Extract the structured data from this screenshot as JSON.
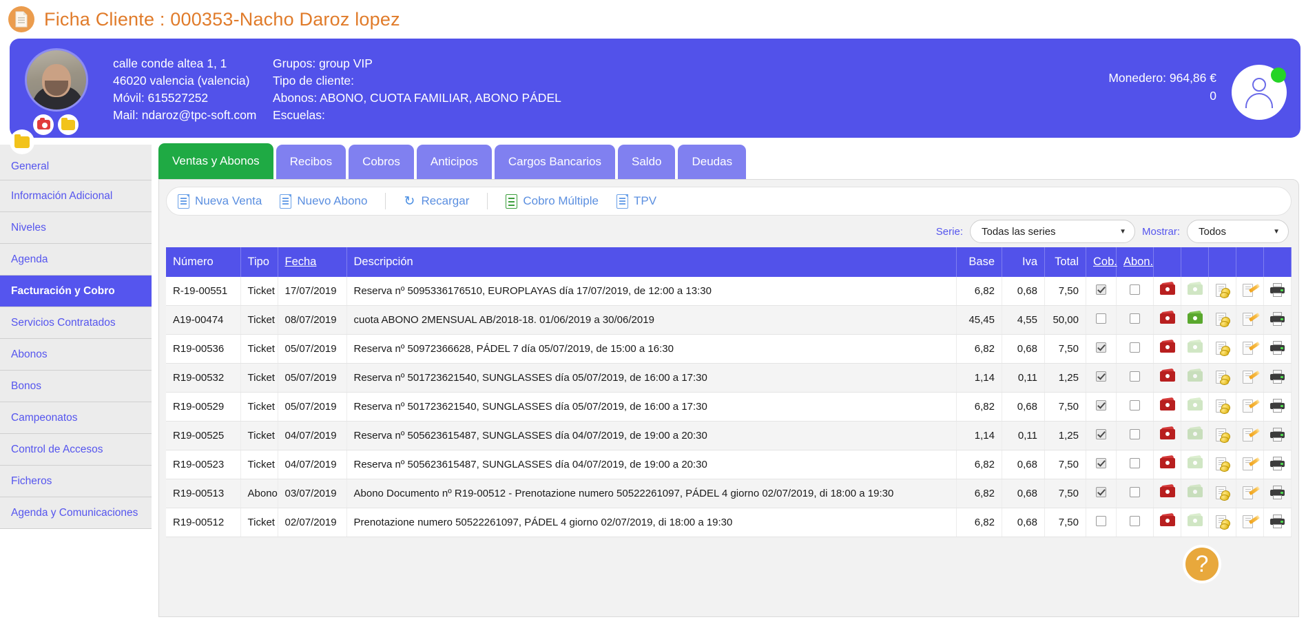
{
  "page": {
    "title": "Ficha Cliente : 000353-Nacho Daroz lopez",
    "doc_icon": "document-icon"
  },
  "client": {
    "address_line1": "calle conde altea 1, 1",
    "address_line2": "46020 valencia (valencia)",
    "mobile": "Móvil: 615527252",
    "mail": "Mail: ndaroz@tpc-soft.com",
    "groups": "Grupos: group VIP",
    "client_type": "Tipo de cliente:",
    "abonos": "Abonos: ABONO, CUOTA FAMILIAR, ABONO PÁDEL",
    "escuelas": "Escuelas:",
    "wallet": "Monedero: 964,86 €",
    "wallet_secondary": "0",
    "photo_badges": [
      "camera-icon",
      "folder-icon"
    ],
    "status": "online"
  },
  "sidebar": {
    "items": [
      {
        "label": "General",
        "active": false
      },
      {
        "label": "Información Adicional",
        "active": false
      },
      {
        "label": "Niveles",
        "active": false
      },
      {
        "label": "Agenda",
        "active": false
      },
      {
        "label": "Facturación y Cobro",
        "active": true
      },
      {
        "label": "Servicios Contratados",
        "active": false
      },
      {
        "label": "Abonos",
        "active": false
      },
      {
        "label": "Bonos",
        "active": false
      },
      {
        "label": "Campeonatos",
        "active": false
      },
      {
        "label": "Control de Accesos",
        "active": false
      },
      {
        "label": "Ficheros",
        "active": false
      },
      {
        "label": "Agenda y Comunicaciones",
        "active": false
      }
    ]
  },
  "tabs": [
    {
      "label": "Ventas y Abonos",
      "active": true
    },
    {
      "label": "Recibos",
      "active": false
    },
    {
      "label": "Cobros",
      "active": false
    },
    {
      "label": "Anticipos",
      "active": false
    },
    {
      "label": "Cargos Bancarios",
      "active": false
    },
    {
      "label": "Saldo",
      "active": false
    },
    {
      "label": "Deudas",
      "active": false
    }
  ],
  "toolbar": {
    "actions": [
      {
        "label": "Nueva Venta",
        "icon": "new-document-icon"
      },
      {
        "label": "Nuevo Abono",
        "icon": "new-document-icon"
      },
      {
        "label": "Recargar",
        "icon": "refresh-icon"
      },
      {
        "label": "Cobro Múltiple",
        "icon": "list-icon"
      },
      {
        "label": "TPV",
        "icon": "new-document-icon"
      }
    ]
  },
  "filters": {
    "serie_label": "Serie:",
    "serie_value": "Todas las series",
    "mostrar_label": "Mostrar:",
    "mostrar_value": "Todos"
  },
  "table": {
    "columns": [
      {
        "key": "numero",
        "label": "Número",
        "sortable": false
      },
      {
        "key": "tipo",
        "label": "Tipo",
        "sortable": false
      },
      {
        "key": "fecha",
        "label": "Fecha",
        "sortable": true
      },
      {
        "key": "descripcion",
        "label": "Descripción",
        "sortable": false
      },
      {
        "key": "base",
        "label": "Base",
        "sortable": false
      },
      {
        "key": "iva",
        "label": "Iva",
        "sortable": false
      },
      {
        "key": "total",
        "label": "Total",
        "sortable": false
      },
      {
        "key": "cob",
        "label": "Cob.",
        "sortable": true
      },
      {
        "key": "abon",
        "label": "Abon.",
        "sortable": true
      }
    ],
    "action_icons": [
      "money-red-icon",
      "money-green-icon",
      "document-coins-icon",
      "document-edit-icon",
      "printer-icon"
    ],
    "rows": [
      {
        "numero": "R-19-00551",
        "tipo": "Ticket",
        "fecha": "17/07/2019",
        "descripcion": "Reserva nº 5095336176510, EUROPLAYAS día 17/07/2019, de 12:00 a 13:30",
        "base": "6,82",
        "iva": "0,68",
        "total": "7,50",
        "cob": true,
        "abon": false,
        "green_active": false
      },
      {
        "numero": "A19-00474",
        "tipo": "Ticket",
        "fecha": "08/07/2019",
        "descripcion": "cuota ABONO 2MENSUAL AB/2018-18. 01/06/2019 a 30/06/2019",
        "base": "45,45",
        "iva": "4,55",
        "total": "50,00",
        "cob": false,
        "abon": false,
        "green_active": true
      },
      {
        "numero": "R19-00536",
        "tipo": "Ticket",
        "fecha": "05/07/2019",
        "descripcion": "Reserva nº 50972366628, PÁDEL 7 día 05/07/2019, de 15:00 a 16:30",
        "base": "6,82",
        "iva": "0,68",
        "total": "7,50",
        "cob": true,
        "abon": false,
        "green_active": false
      },
      {
        "numero": "R19-00532",
        "tipo": "Ticket",
        "fecha": "05/07/2019",
        "descripcion": "Reserva nº 501723621540, SUNGLASSES día 05/07/2019, de 16:00 a 17:30",
        "base": "1,14",
        "iva": "0,11",
        "total": "1,25",
        "cob": true,
        "abon": false,
        "green_active": false
      },
      {
        "numero": "R19-00529",
        "tipo": "Ticket",
        "fecha": "05/07/2019",
        "descripcion": "Reserva nº 501723621540, SUNGLASSES día 05/07/2019, de 16:00 a 17:30",
        "base": "6,82",
        "iva": "0,68",
        "total": "7,50",
        "cob": true,
        "abon": false,
        "green_active": false
      },
      {
        "numero": "R19-00525",
        "tipo": "Ticket",
        "fecha": "04/07/2019",
        "descripcion": "Reserva nº 505623615487, SUNGLASSES día 04/07/2019, de 19:00 a 20:30",
        "base": "1,14",
        "iva": "0,11",
        "total": "1,25",
        "cob": true,
        "abon": false,
        "green_active": false
      },
      {
        "numero": "R19-00523",
        "tipo": "Ticket",
        "fecha": "04/07/2019",
        "descripcion": "Reserva nº 505623615487, SUNGLASSES día 04/07/2019, de 19:00 a 20:30",
        "base": "6,82",
        "iva": "0,68",
        "total": "7,50",
        "cob": true,
        "abon": false,
        "green_active": false
      },
      {
        "numero": "R19-00513",
        "tipo": "Abono",
        "fecha": "03/07/2019",
        "descripcion": "Abono Documento nº R19-00512 - Prenotazione numero 50522261097, PÁDEL 4 giorno 02/07/2019, di 18:00 a 19:30",
        "base": "6,82",
        "iva": "0,68",
        "total": "7,50",
        "cob": true,
        "abon": false,
        "green_active": false
      },
      {
        "numero": "R19-00512",
        "tipo": "Ticket",
        "fecha": "02/07/2019",
        "descripcion": "Prenotazione numero 50522261097, PÁDEL 4 giorno 02/07/2019, di 18:00 a 19:30",
        "base": "6,82",
        "iva": "0,68",
        "total": "7,50",
        "cob": false,
        "abon": false,
        "green_active": false
      }
    ]
  },
  "help": {
    "label": "?"
  },
  "colors": {
    "brand_blue": "#5252ea",
    "tab_blue": "#8080f0",
    "active_green": "#1faa44",
    "title_orange": "#e07b2a",
    "link_blue": "#5b8fe0"
  }
}
